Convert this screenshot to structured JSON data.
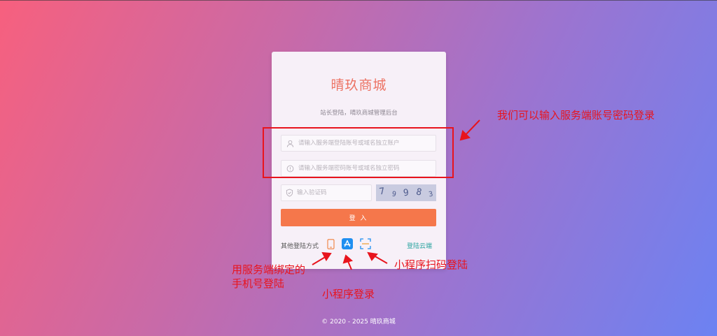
{
  "login": {
    "title": "晴玖商城",
    "subtitle": "站长登陆，晴玖商城管理后台",
    "username_placeholder": "请输入服务端登陆账号或域名独立账户",
    "password_placeholder": "请输入服务端密码账号或域名独立密码",
    "captcha_placeholder": "输入验证码",
    "captcha_chars": [
      "7",
      "9",
      "9",
      "8",
      "3"
    ],
    "login_button": "登 入",
    "other_methods_label": "其他登陆方式",
    "cloud_login_link": "登陆云端"
  },
  "footer": {
    "copyright": "© 2020 - 2025  晴玖商城"
  },
  "annotations": {
    "account_note": "我们可以输入服务端账号密码登录",
    "phone_note": "用服务端绑定的手机号登陆",
    "miniapp_note": "小程序登录",
    "scan_note": "小程序扫码登陆"
  },
  "colors": {
    "accent": "#f5774b",
    "title": "#ec7364",
    "link": "#2ba4a0",
    "annotation": "#e8141d",
    "app_icon": "#1f8ff0"
  },
  "icons": [
    "user-icon",
    "info-icon",
    "shield-icon",
    "phone-icon",
    "app-store-icon",
    "scan-icon"
  ]
}
